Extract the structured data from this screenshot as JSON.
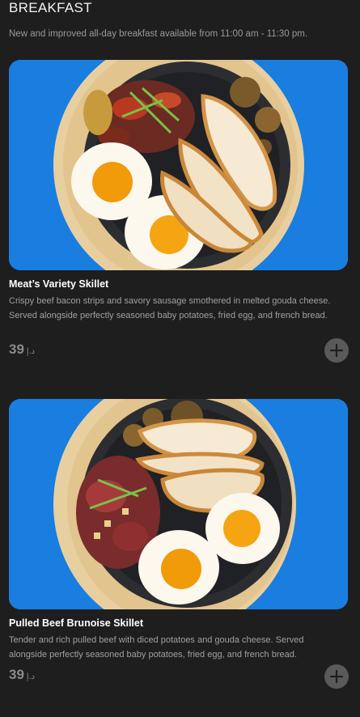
{
  "section": {
    "title": "BREAKFAST",
    "subtitle": "New and improved all-day breakfast available from 11:00 am - 11:30 pm."
  },
  "items": [
    {
      "name": "Meat’s Variety Skillet",
      "description": "Crispy beef bacon strips and savory sausage smothered in melted gouda cheese. Served alongside perfectly seasoned baby potatoes, fried egg, and french bread.",
      "price": "39",
      "currency": "د.إ",
      "add_icon": "plus-icon"
    },
    {
      "name": "Pulled Beef Brunoise Skillet",
      "description": "Tender and rich pulled beef with diced potatoes and gouda cheese. Served alongside perfectly seasoned baby potatoes, fried egg, and french bread.",
      "price": "39",
      "currency": "د.إ",
      "add_icon": "plus-icon"
    }
  ],
  "colors": {
    "background": "#1e1e1e",
    "image_bg": "#1a7de0",
    "add_button": "#5a5a5a"
  }
}
